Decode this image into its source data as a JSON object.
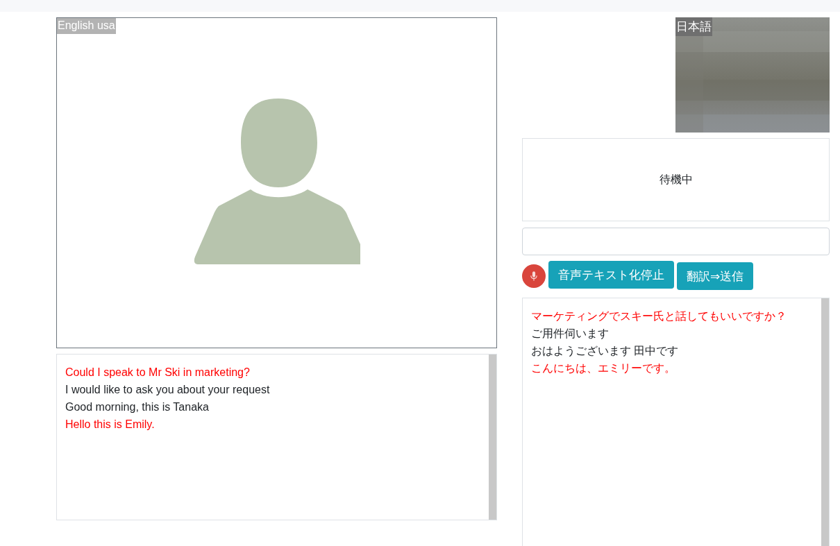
{
  "local_video": {
    "language": "English usa"
  },
  "local_transcript": [
    {
      "text": "Could I speak to Mr Ski in marketing?",
      "color": "#ff0000"
    },
    {
      "text": "I would like to ask you about your request",
      "color": "#212529"
    },
    {
      "text": "Good morning, this is Tanaka",
      "color": "#212529"
    },
    {
      "text": "Hello this is Emily.",
      "color": "#ff0000"
    }
  ],
  "remote_video": {
    "language": "日本語",
    "kind": "picture"
  },
  "status": "待機中",
  "mic": {
    "on": true
  },
  "buttons": [
    "音声テキスト化停止",
    "翻訳⇒送信"
  ],
  "remote_transcript": [
    {
      "text": "マーケティングでスキー氏と話してもいいですか？",
      "color": "#ff0000"
    },
    {
      "text": "ご用件伺います",
      "color": "#212529"
    },
    {
      "text": "おはようございます 田中です",
      "color": "#212529"
    },
    {
      "text": "こんにちは、エミリーです。",
      "color": "#ff0000"
    }
  ]
}
